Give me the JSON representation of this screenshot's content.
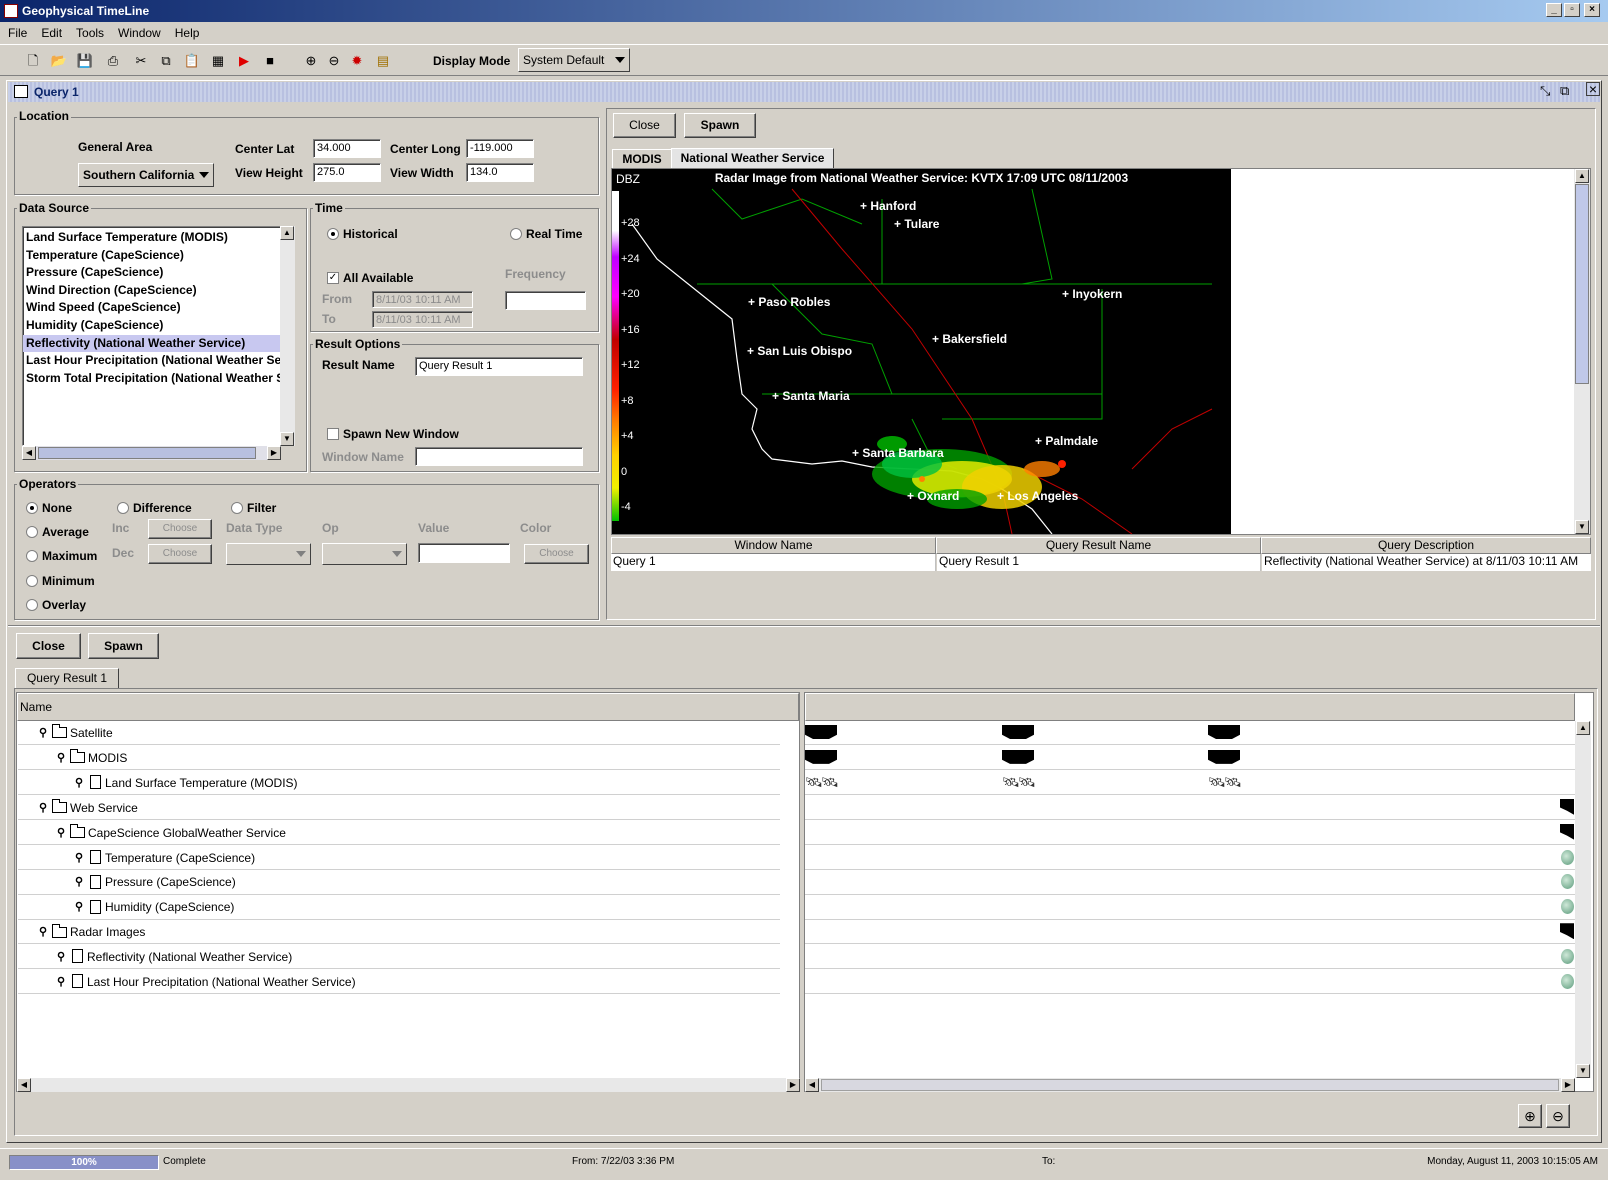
{
  "app": {
    "title": "Geophysical TimeLine"
  },
  "menu": [
    "File",
    "Edit",
    "Tools",
    "Window",
    "Help"
  ],
  "toolbar": {
    "display_mode_label": "Display Mode",
    "display_mode_value": "System Default"
  },
  "query_window": {
    "title": "Query 1"
  },
  "location": {
    "title": "Location",
    "general_area_label": "General Area",
    "general_area_value": "Southern California",
    "center_lat_label": "Center Lat",
    "center_lat": "34.000",
    "center_long_label": "Center Long",
    "center_long": "-119.000",
    "view_height_label": "View Height",
    "view_height": "275.0",
    "view_width_label": "View Width",
    "view_width": "134.0"
  },
  "data_source": {
    "title": "Data Source",
    "items": [
      "Land Surface Temperature (MODIS)",
      "Temperature (CapeScience)",
      "Pressure (CapeScience)",
      "Wind Direction (CapeScience)",
      "Wind Speed (CapeScience)",
      "Humidity (CapeScience)",
      "Reflectivity (National Weather Service)",
      "Last Hour Precipitation (National Weather Ser",
      "Storm Total Precipitation (National Weather S"
    ],
    "selected_index": 6
  },
  "time": {
    "title": "Time",
    "historical": "Historical",
    "real_time": "Real Time",
    "all_available": "All Available",
    "frequency": "Frequency",
    "from_label": "From",
    "from_value": "8/11/03 10:11 AM",
    "to_label": "To",
    "to_value": "8/11/03 10:11 AM"
  },
  "result_options": {
    "title": "Result Options",
    "result_name_label": "Result Name",
    "result_name": "Query Result 1",
    "spawn_new_window": "Spawn New Window",
    "window_name_label": "Window Name"
  },
  "operators": {
    "title": "Operators",
    "none": "None",
    "difference": "Difference",
    "filter": "Filter",
    "average": "Average",
    "maximum": "Maximum",
    "minimum": "Minimum",
    "overlay": "Overlay",
    "inc": "Inc",
    "dec": "Dec",
    "choose": "Choose",
    "data_type": "Data Type",
    "op": "Op",
    "value": "Value",
    "color": "Color"
  },
  "viewer": {
    "close": "Close",
    "spawn": "Spawn",
    "tabs": [
      "MODIS",
      "National Weather Service"
    ],
    "radar_title": "Radar Image from National Weather Service: KVTX   17:09 UTC  08/11/2003",
    "dbz_label": "DBZ",
    "dbz_ticks": [
      "+28",
      "+24",
      "+20",
      "+16",
      "+12",
      "+8",
      "+4",
      "0",
      "-4"
    ],
    "cities": [
      "Hanford",
      "Tulare",
      "Paso Robles",
      "Inyokern",
      "Bakersfield",
      "San Luis Obispo",
      "Santa Maria",
      "Palmdale",
      "Santa Barbara",
      "Oxnard",
      "Los Angeles"
    ],
    "table_headers": [
      "Window Name",
      "Query Result Name",
      "Query Description"
    ],
    "table_row": [
      "Query 1",
      "Query Result 1",
      "Reflectivity (National Weather Service) at 8/11/03 10:11 AM"
    ]
  },
  "results": {
    "close": "Close",
    "spawn": "Spawn",
    "tab": "Query Result 1",
    "name_header": "Name",
    "tree": [
      {
        "label": "Satellite",
        "type": "folder",
        "depth": 0
      },
      {
        "label": "MODIS",
        "type": "folder",
        "depth": 1
      },
      {
        "label": "Land Surface Temperature (MODIS)",
        "type": "doc",
        "depth": 2
      },
      {
        "label": "Web Service",
        "type": "folder",
        "depth": 0
      },
      {
        "label": "CapeScience GlobalWeather Service",
        "type": "folder",
        "depth": 1
      },
      {
        "label": "Temperature (CapeScience)",
        "type": "doc",
        "depth": 2
      },
      {
        "label": "Pressure (CapeScience)",
        "type": "doc",
        "depth": 2
      },
      {
        "label": "Humidity (CapeScience)",
        "type": "doc",
        "depth": 2
      },
      {
        "label": "Radar Images",
        "type": "folder",
        "depth": 0
      },
      {
        "label": "Reflectivity (National Weather Service)",
        "type": "doc",
        "depth": 1
      },
      {
        "label": "Last Hour Precipitation (National Weather Service)",
        "type": "doc",
        "depth": 1
      }
    ]
  },
  "status": {
    "progress_text": "100%",
    "progress": 1.0,
    "state": "Complete",
    "from": "From:  7/22/03 3:36 PM",
    "to": "To:",
    "datetime": "Monday, August 11, 2003 10:15:05 AM"
  }
}
